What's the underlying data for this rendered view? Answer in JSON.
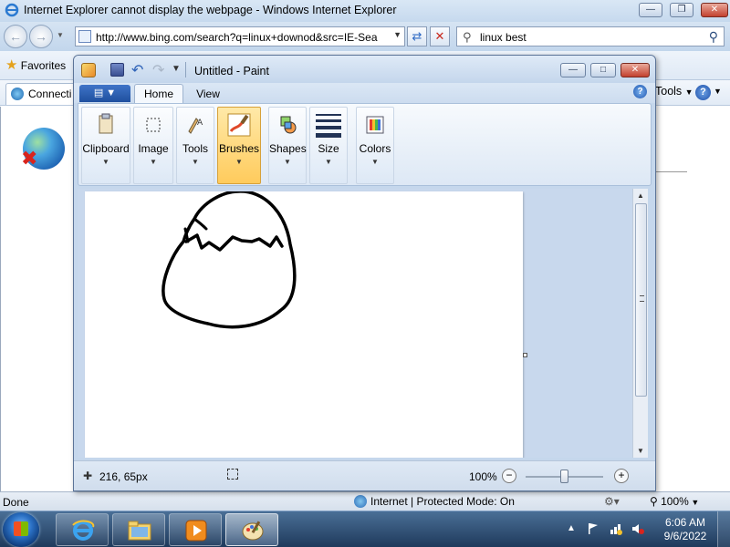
{
  "ie": {
    "title": "Internet Explorer cannot display the webpage - Windows Internet Explorer",
    "address": "http://www.bing.com/search?q=linux+downod&src=IE-Sea",
    "search_text": "linux best",
    "favorites_label": "Favorites",
    "tab_label": "Connecti",
    "tools_label": "Tools",
    "status_done": "Done",
    "status_zone": "Internet | Protected Mode: On",
    "status_zoom": "100%"
  },
  "paint": {
    "title": "Untitled - Paint",
    "tabs": {
      "home": "Home",
      "view": "View"
    },
    "ribbon_groups": [
      {
        "label": "Clipboard",
        "icon": "clipboard-icon"
      },
      {
        "label": "Image",
        "icon": "select-icon"
      },
      {
        "label": "Tools",
        "icon": "tools-icon"
      },
      {
        "label": "Brushes",
        "icon": "brush-icon",
        "active": true
      },
      {
        "label": "Shapes",
        "icon": "shapes-icon"
      },
      {
        "label": "Size",
        "icon": "line-size-icon"
      },
      {
        "label": "Colors",
        "icon": "colors-icon"
      }
    ],
    "status_position": "216, 65px",
    "zoom_level": "100%",
    "zoom_fraction": 0.5
  },
  "taskbar": {
    "time": "6:06 AM",
    "date": "9/6/2022",
    "pinned": [
      {
        "name": "internet-explorer-icon"
      },
      {
        "name": "windows-explorer-icon"
      },
      {
        "name": "media-player-icon"
      },
      {
        "name": "paint-icon",
        "active": true
      }
    ]
  },
  "colors": {
    "brushes_active": "#ffcb5c",
    "close_button": "#c3412f",
    "taskbar": "#1f3a5c"
  }
}
